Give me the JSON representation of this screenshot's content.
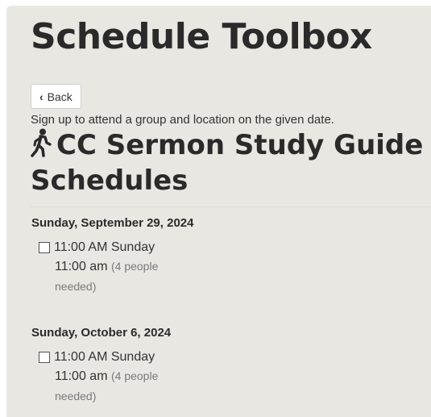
{
  "app": {
    "title": "Schedule Toolbox"
  },
  "toolbar": {
    "back_label": "Back"
  },
  "intro_text": "Sign up to attend a group and location on the given date.",
  "section": {
    "title": "CC Sermon Study Guide Schedules",
    "icon": "walking-person-icon"
  },
  "dates": [
    {
      "heading": "Sunday, September 29, 2024",
      "slot": {
        "name": "11:00 AM Sunday",
        "time": "11:00 am",
        "need_open": "(4 people",
        "need_close": "needed)",
        "checked": false
      }
    },
    {
      "heading": "Sunday, October 6, 2024",
      "slot": {
        "name": "11:00 AM Sunday",
        "time": "11:00 am",
        "need_open": "(4 people",
        "need_close": "needed)",
        "checked": false
      }
    }
  ]
}
